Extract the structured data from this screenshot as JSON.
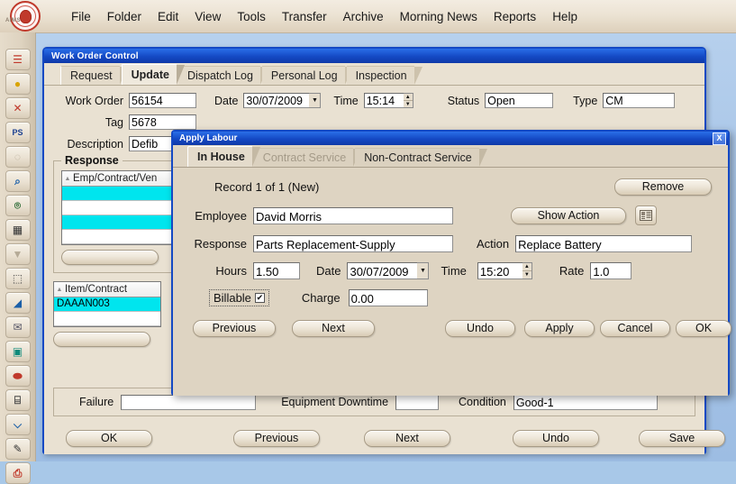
{
  "app": {
    "logo_text": "AIMS",
    "menu": [
      {
        "label": "File",
        "name": "menu-file"
      },
      {
        "label": "Folder",
        "name": "menu-folder"
      },
      {
        "label": "Edit",
        "name": "menu-edit"
      },
      {
        "label": "View",
        "name": "menu-view"
      },
      {
        "label": "Tools",
        "name": "menu-tools"
      },
      {
        "label": "Transfer",
        "name": "menu-transfer"
      },
      {
        "label": "Archive",
        "name": "menu-archive"
      },
      {
        "label": "Morning News",
        "name": "menu-morning-news"
      },
      {
        "label": "Reports",
        "name": "menu-reports"
      },
      {
        "label": "Help",
        "name": "menu-help"
      }
    ]
  },
  "sidebar": {
    "items": [
      {
        "icon": "book-red-icon",
        "glyph": "☰",
        "color": "#c0392b"
      },
      {
        "icon": "money-bag-icon",
        "glyph": "●",
        "color": "#d9a400"
      },
      {
        "icon": "delete-cross-icon",
        "glyph": "✕",
        "color": "#c0392b"
      },
      {
        "icon": "ps-icon",
        "glyph": "PS",
        "color": "#1a3f8f"
      },
      {
        "icon": "search-disabled-icon",
        "glyph": "◌",
        "color": "#b5aa96"
      },
      {
        "icon": "magnifier-icon",
        "glyph": "⌕",
        "color": "#1a5fa8"
      },
      {
        "icon": "find-document-icon",
        "glyph": "⌾",
        "color": "#2a6a34"
      },
      {
        "icon": "table-grid-icon",
        "glyph": "▦",
        "color": "#333"
      },
      {
        "icon": "dropdown-disabled-icon",
        "glyph": "▼",
        "color": "#b5aa96"
      },
      {
        "icon": "photo-frame-icon",
        "glyph": "⬚",
        "color": "#444"
      },
      {
        "icon": "paint-bucket-icon",
        "glyph": "◢",
        "color": "#1a5fa8"
      },
      {
        "icon": "envelope-icon",
        "glyph": "✉",
        "color": "#556"
      },
      {
        "icon": "camera-icon",
        "glyph": "▣",
        "color": "#0d8a7a"
      },
      {
        "icon": "stamp-red-icon",
        "glyph": "⬬",
        "color": "#c0392b"
      },
      {
        "icon": "notebook-icon",
        "glyph": "⌸",
        "color": "#444"
      },
      {
        "icon": "scanner-icon",
        "glyph": "⌵",
        "color": "#1a5fa8"
      },
      {
        "icon": "edit-note-icon",
        "glyph": "✎",
        "color": "#333"
      },
      {
        "icon": "printer-icon",
        "glyph": "⎙",
        "color": "#c0392b"
      }
    ]
  },
  "work_order_window": {
    "title": "Work Order Control",
    "tabs": [
      {
        "label": "Request",
        "active": false
      },
      {
        "label": "Update",
        "active": true
      },
      {
        "label": "Dispatch Log",
        "active": false
      },
      {
        "label": "Personal Log",
        "active": false
      },
      {
        "label": "Inspection",
        "active": false
      }
    ],
    "fields": {
      "work_order_label": "Work Order",
      "work_order_value": "56154",
      "date_label": "Date",
      "date_value": "30/07/2009",
      "time_label": "Time",
      "time_value": "15:14",
      "status_label": "Status",
      "status_value": "Open",
      "type_label": "Type",
      "type_value": "CM",
      "tag_label": "Tag",
      "tag_value": "5678",
      "description_label": "Description",
      "description_value": "Defib"
    },
    "response_group": {
      "title": "Response",
      "grid_header": "Emp/Contract/Ven",
      "rows": [
        {
          "value": "",
          "selected": true
        },
        {
          "value": "",
          "selected": false
        },
        {
          "value": "",
          "selected": true
        },
        {
          "value": "",
          "selected": false
        }
      ],
      "action_button": ""
    },
    "item_grid": {
      "header": "Item/Contract",
      "rows": [
        {
          "value": "DAAAN003",
          "selected": true
        },
        {
          "value": "",
          "selected": false
        }
      ],
      "action_button": ""
    },
    "bottom_fields": {
      "failure_label": "Failure",
      "failure_value": "",
      "downtime_label": "Equipment Downtime",
      "downtime_value": "",
      "condition_label": "Condition",
      "condition_value": "Good-1"
    },
    "buttons": [
      {
        "label": "OK",
        "name": "woc-ok-button"
      },
      {
        "label": "Previous",
        "name": "woc-previous-button"
      },
      {
        "label": "Next",
        "name": "woc-next-button"
      },
      {
        "label": "Undo",
        "name": "woc-undo-button"
      },
      {
        "label": "Save",
        "name": "woc-save-button"
      }
    ]
  },
  "apply_labour_dialog": {
    "title": "Apply Labour",
    "close_label": "X",
    "tabs": [
      {
        "label": "In House",
        "active": true,
        "disabled": false
      },
      {
        "label": "Contract Service",
        "active": false,
        "disabled": true
      },
      {
        "label": "Non-Contract Service",
        "active": false,
        "disabled": false
      }
    ],
    "record_text": "Record 1 of 1 (New)",
    "remove_button": "Remove",
    "employee_label": "Employee",
    "employee_value": "David Morris",
    "show_action_button": "Show Action",
    "action_picker_icon": "contacts-icon",
    "response_label": "Response",
    "response_value": "Parts Replacement-Supply",
    "action_label": "Action",
    "action_value": "Replace Battery",
    "hours_label": "Hours",
    "hours_value": "1.50",
    "date_label": "Date",
    "date_value": "30/07/2009",
    "time_label": "Time",
    "time_value": "15:20",
    "rate_label": "Rate",
    "rate_value": "1.0",
    "billable_label": "Billable",
    "billable_checked": "✔",
    "charge_label": "Charge",
    "charge_value": "0.00",
    "buttons": [
      {
        "label": "Previous",
        "name": "dlg-previous-button"
      },
      {
        "label": "Next",
        "name": "dlg-next-button"
      },
      {
        "label": "Undo",
        "name": "dlg-undo-button"
      },
      {
        "label": "Apply",
        "name": "dlg-apply-button"
      },
      {
        "label": "Cancel",
        "name": "dlg-cancel-button"
      },
      {
        "label": "OK",
        "name": "dlg-ok-button"
      }
    ]
  },
  "colors": {
    "titlebar_blue": "#1449c4",
    "grid_selection_cyan": "#00e5ee",
    "form_beige": "#e9e1d2",
    "dialog_beige": "#ded4c2",
    "desktop_blue": "#a8c8e8",
    "logo_red": "#c0392b"
  }
}
